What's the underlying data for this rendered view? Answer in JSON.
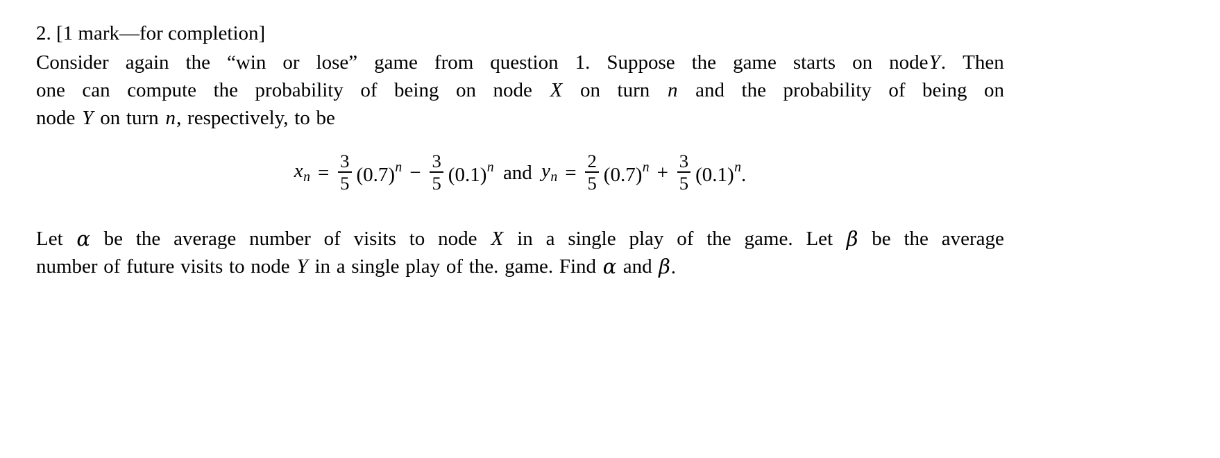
{
  "document": {
    "question_number": "2.",
    "marks_note": "[1 mark—for completion]",
    "heading_full": "2. [1 mark—for completion]",
    "paragraph1": {
      "full_text": "Consider again the “win or lose” game from question 1. Suppose the game starts on node Y. Then one can compute the probability of being on node X on turn n and the probability of being on node Y on turn n, respectively, to be",
      "line1": {
        "w1": "Consider",
        "w2": "again",
        "w3": "the",
        "w4": "“win",
        "w5": "or",
        "w6": "lose”",
        "w7": "game",
        "w8": "from",
        "w9": "question",
        "w10": "1.",
        "w11": "Suppose",
        "w12": "the",
        "w13": "game",
        "w14": "starts",
        "w15": "on",
        "w16": "node",
        "w17": "Y",
        "w18": ".",
        "w19": "Then"
      },
      "line2": {
        "w1": "one",
        "w2": "can",
        "w3": "compute",
        "w4": "the",
        "w5": "probability",
        "w6": "of",
        "w7": "being",
        "w8": "on",
        "w9": "node",
        "w10": "X",
        "w11": "on",
        "w12": "turn",
        "w13": "n",
        "w14": "and",
        "w15": "the",
        "w16": "probability",
        "w17": "of",
        "w18": "being",
        "w19": "on"
      },
      "line3": {
        "w1": "node",
        "w2": "Y",
        "w3": "on",
        "w4": "turn",
        "w5": "n",
        "w6": ",",
        "w7": "respectively,",
        "w8": "to",
        "w9": "be"
      }
    },
    "equation": {
      "latex": "x_n = \\frac{3}{5}(0.7)^n - \\frac{3}{5}(0.1)^n \\text{ and } y_n = \\frac{2}{5}(0.7)^n + \\frac{3}{5}(0.1)^n.",
      "plain_text": "x_n = (3/5)(0.7)^n − (3/5)(0.1)^n and y_n = (2/5)(0.7)^n + (3/5)(0.1)^n.",
      "lhs_x": {
        "var": "x",
        "sub": "n"
      },
      "equals": "=",
      "term1": {
        "num": "3",
        "den": "5",
        "base": "(0.7)",
        "exp": "n"
      },
      "op1": "−",
      "term2": {
        "num": "3",
        "den": "5",
        "base": "(0.1)",
        "exp": "n"
      },
      "conjunction": "and",
      "lhs_y": {
        "var": "y",
        "sub": "n"
      },
      "term3": {
        "num": "2",
        "den": "5",
        "base": "(0.7)",
        "exp": "n"
      },
      "op2": "+",
      "term4": {
        "num": "3",
        "den": "5",
        "base": "(0.1)",
        "exp": "n"
      },
      "terminator": "."
    },
    "paragraph2": {
      "full_text": "Let α be the average number of visits to node X in a single play of the game. Let β be the average number of future visits to node Y in a single play of the. game. Find α and β.",
      "line1": {
        "w1": "Let",
        "w2": "α",
        "w3": "be",
        "w4": "the",
        "w5": "average",
        "w6": "number",
        "w7": "of",
        "w8": "visits",
        "w9": "to",
        "w10": "node",
        "w11": "X",
        "w12": "in",
        "w13": "a",
        "w14": "single",
        "w15": "play",
        "w16": "of",
        "w17": "the",
        "w18": "game.",
        "w19": "Let",
        "w20": "β",
        "w21": "be",
        "w22": "the",
        "w23": "average"
      },
      "line2": {
        "w1": "number",
        "w2": "of",
        "w3": "future",
        "w4": "visits",
        "w5": "to",
        "w6": "node",
        "w7": "Y",
        "w8": "in",
        "w9": "a",
        "w10": "single",
        "w11": "play",
        "w12": "of",
        "w13": "the.",
        "w14": "game.",
        "w15": "Find",
        "w16": "α",
        "w17": "and",
        "w18": "β",
        "w19": "."
      }
    },
    "colors": {
      "text": "#000000",
      "background": "#ffffff"
    }
  }
}
